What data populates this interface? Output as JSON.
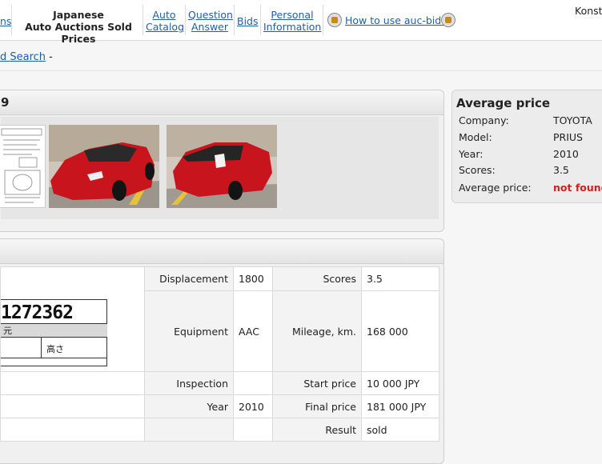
{
  "nav": {
    "cut_left": "ns",
    "title_line1": "Japanese",
    "title_line2": "Auto Auctions Sold Prices",
    "auto_catalog_1": "Auto",
    "auto_catalog_2": "Catalog",
    "qa_1": "Question",
    "qa_2": "Answer",
    "bids": "Bids",
    "personal_1": "Personal",
    "personal_2": "Information",
    "how_to": "How to use auc-bid?",
    "user": "Konst"
  },
  "breadcrumb": {
    "link": "d Search",
    "sep": " -"
  },
  "lot": {
    "title_tail": "9"
  },
  "average_price": {
    "title": "Average price",
    "rows": [
      {
        "label": "Company:",
        "value": "TOYOTA"
      },
      {
        "label": "Model:",
        "value": "PRIUS"
      },
      {
        "label": "Year:",
        "value": "2010"
      },
      {
        "label": "Scores:",
        "value": "3.5"
      },
      {
        "label": "Average price:",
        "value": "not found"
      }
    ]
  },
  "sheet": {
    "number": "1272362",
    "char1": "元",
    "char2": "高さ"
  },
  "info": {
    "displacement_label": "Displacement",
    "displacement": "1800",
    "scores_label": "Scores",
    "scores": "3.5",
    "equipment_label": "Equipment",
    "equipment": "AAC",
    "mileage_label": "Mileage, km.",
    "mileage": "168 000",
    "inspection_label": "Inspection",
    "start_label": "Start price",
    "start": "10 000 JPY",
    "year_label": "Year",
    "year": "2010",
    "final_label": "Final price",
    "final": "181 000 JPY",
    "result_label": "Result",
    "result": "sold"
  },
  "colors": {
    "link": "#1f5fa8",
    "not_found": "#d0211e",
    "car_red": "#c8141c"
  }
}
